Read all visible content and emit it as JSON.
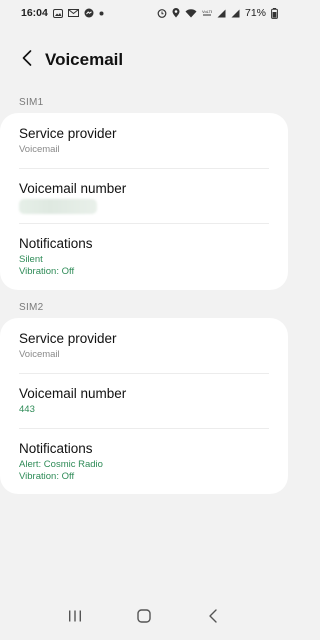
{
  "status_bar": {
    "time": "16:04",
    "battery": "71%",
    "icons_left": [
      "gallery-icon",
      "mail-icon",
      "messenger-icon",
      "dot-icon"
    ],
    "icons_right": [
      "alarm-icon",
      "location-icon",
      "wifi-icon",
      "volte-icon",
      "signal-icon",
      "signal-icon",
      "battery-icon"
    ]
  },
  "app_bar": {
    "title": "Voicemail"
  },
  "sim1": {
    "label": "SIM1",
    "service_provider": {
      "title": "Service provider",
      "value": "Voicemail"
    },
    "voicemail_number": {
      "title": "Voicemail number",
      "value": ""
    },
    "notifications": {
      "title": "Notifications",
      "line1": "Silent",
      "line2": "Vibration: Off"
    }
  },
  "sim2": {
    "label": "SIM2",
    "service_provider": {
      "title": "Service provider",
      "value": "Voicemail"
    },
    "voicemail_number": {
      "title": "Voicemail number",
      "value": "443"
    },
    "notifications": {
      "title": "Notifications",
      "line1": "Alert: Cosmic Radio",
      "line2": "Vibration: Off"
    }
  },
  "colors": {
    "background": "#f2f2f2",
    "card": "#ffffff",
    "accent": "#2e8b57",
    "secondary_text": "#8a8a8a"
  },
  "nav_bar": {
    "buttons": [
      "recents-icon",
      "home-icon",
      "back-icon"
    ]
  }
}
